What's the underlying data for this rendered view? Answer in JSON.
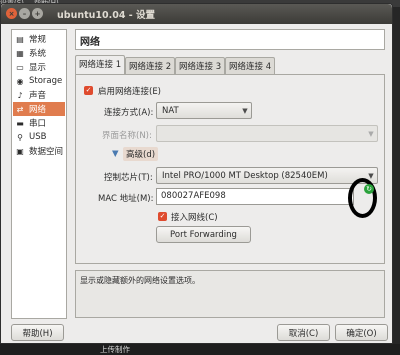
{
  "background": {
    "top_menu": [
      "设置(S)",
      "帮助(H)"
    ],
    "bottom_text": "上传制作"
  },
  "window": {
    "title": "ubuntu10.04 - 设置",
    "controls": {
      "close": "×",
      "minimize": "–",
      "maximize": "+"
    }
  },
  "sidebar": {
    "items": [
      {
        "label": "常规",
        "icon": "general-icon",
        "glyph": "▤"
      },
      {
        "label": "系统",
        "icon": "system-icon",
        "glyph": "▦"
      },
      {
        "label": "显示",
        "icon": "display-icon",
        "glyph": "▭"
      },
      {
        "label": "Storage",
        "icon": "storage-icon",
        "glyph": "◉"
      },
      {
        "label": "声音",
        "icon": "audio-icon",
        "glyph": "♪"
      },
      {
        "label": "网络",
        "icon": "network-icon",
        "glyph": "⇄",
        "selected": true
      },
      {
        "label": "串口",
        "icon": "serial-port-icon",
        "glyph": "▬"
      },
      {
        "label": "USB",
        "icon": "usb-icon",
        "glyph": "⚲"
      },
      {
        "label": "数据空间",
        "icon": "shared-folder-icon",
        "glyph": "▣"
      }
    ]
  },
  "header": {
    "title": "网络"
  },
  "tabs": [
    {
      "label": "网络连接 1",
      "active": true
    },
    {
      "label": "网络连接 2"
    },
    {
      "label": "网络连接 3"
    },
    {
      "label": "网络连接 4"
    }
  ],
  "adapter": {
    "enable_label": "启用网络连接(E)",
    "enable_checked": true,
    "attached_label": "连接方式(A):",
    "attached_value": "NAT",
    "name_label": "界面名称(N):",
    "name_value": "",
    "advanced_label": "高级(d)",
    "chip_label": "控制芯片(T):",
    "chip_value": "Intel PRO/1000 MT Desktop (82540EM)",
    "mac_label": "MAC 地址(M):",
    "mac_value": "080027AFE098",
    "cable_label": "接入网线(C)",
    "cable_checked": true,
    "port_forwarding_label": "Port Forwarding"
  },
  "description": "显示或隐藏额外的网络设置选项。",
  "buttons": {
    "help": "帮助(H)",
    "cancel": "取消(C)",
    "ok": "确定(O)"
  },
  "colors": {
    "selection": "#e07c4e",
    "checkbox": "#df4b2e",
    "refresh_button": "#2aa23b",
    "annotation_circle": "#000000"
  }
}
